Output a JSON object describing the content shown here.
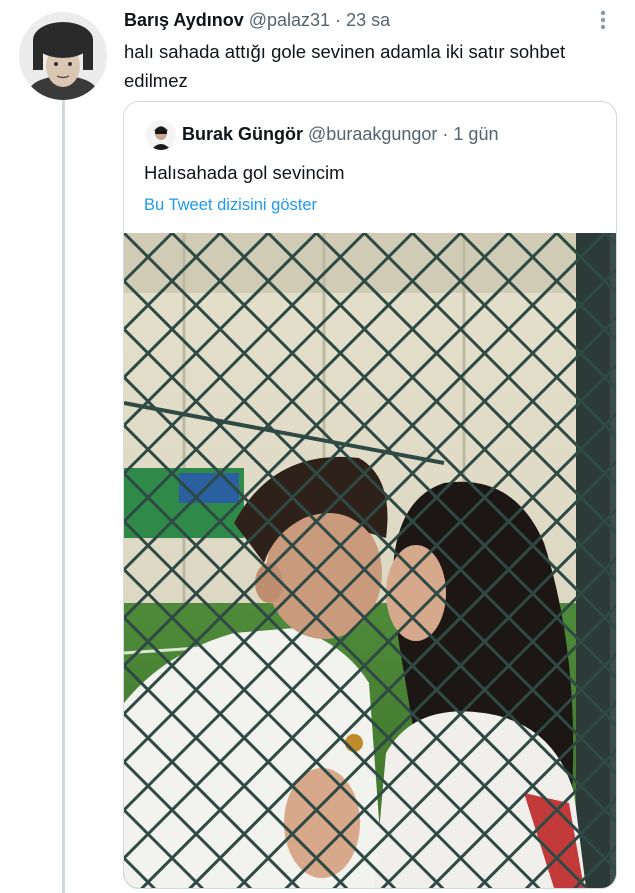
{
  "tweet": {
    "author_name": "Barış Aydınov",
    "handle": "@palaz31",
    "separator": "·",
    "time": "23 sa",
    "text": "halı sahada attığı gole sevinen adamla iki satır sohbet edilmez"
  },
  "quoted_tweet": {
    "author_name": "Burak Güngör",
    "handle": "@buraakgungor",
    "separator": "·",
    "time": "1 gün",
    "text": "Halısahada gol sevincim",
    "thread_link": "Bu Tweet dizisini göster"
  },
  "icons": {
    "more": "more-vertical-icon"
  },
  "colors": {
    "link": "#1d9bf0",
    "muted": "#536471",
    "border": "#cfd9de"
  }
}
